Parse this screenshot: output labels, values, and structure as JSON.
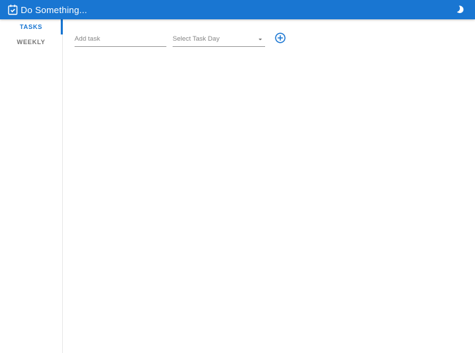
{
  "app_bar": {
    "title": "Do Something...",
    "logo_icon": "calendar-check-icon",
    "theme_toggle_icon": "moon-icon",
    "background_color": "#1976d2",
    "text_color": "#ffffff"
  },
  "sidebar": {
    "tabs": [
      {
        "label": "TASKS",
        "selected": true
      },
      {
        "label": "WEEKLY",
        "selected": false
      }
    ],
    "selected_color": "#1976d2",
    "unselected_color": "#757575"
  },
  "task_form": {
    "task_input": {
      "placeholder": "Add task",
      "value": ""
    },
    "day_select": {
      "value": "Select Task Day",
      "arrow_icon": "arrow-drop-down-icon"
    },
    "add_button_icon": "add-circle-outline-icon",
    "accent_color": "#1976d2"
  }
}
